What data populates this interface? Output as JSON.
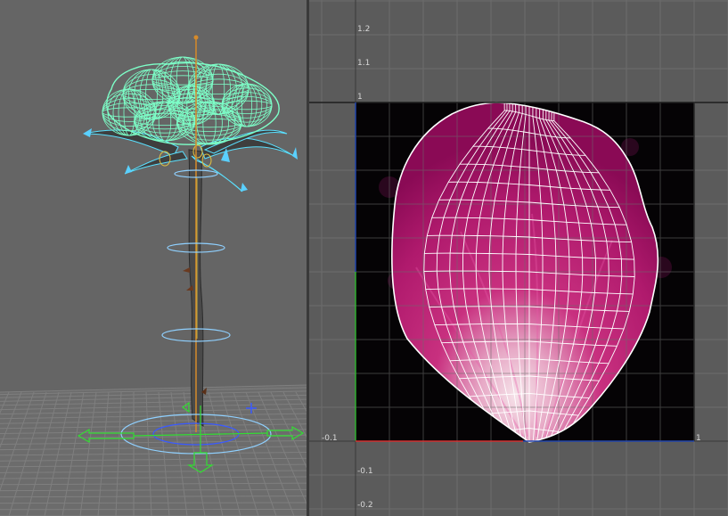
{
  "viewport3d": {
    "colors": {
      "background": "#656565",
      "floor_grid": "#8a8a8a",
      "wireframe": "#7dffc8",
      "stem": "#4a4a4a",
      "pivot": "#d58a2a",
      "control_rings": "#8fd0ff",
      "move_arrows": "#33dd33"
    }
  },
  "uv_editor": {
    "axis_labels": {
      "y_1_2": "1.2",
      "y_1_1": "1.1",
      "y_1": "1",
      "x_neg_0_1": "-0.1",
      "x_1": "1",
      "y_neg_0_1": "-0.1",
      "y_neg_0_2": "-0.2"
    },
    "colors": {
      "background": "#5b5b5b",
      "grid": "#6a6a6a",
      "texture_bg": "#050305",
      "petal_dark": "#8a0a55",
      "petal_mid": "#c01b79",
      "petal_light": "#f2d4e0",
      "uv_mesh": "#ffffff",
      "axis_u": "#d03030",
      "axis_v": "#30b030",
      "border_blue": "#2244aa"
    }
  }
}
